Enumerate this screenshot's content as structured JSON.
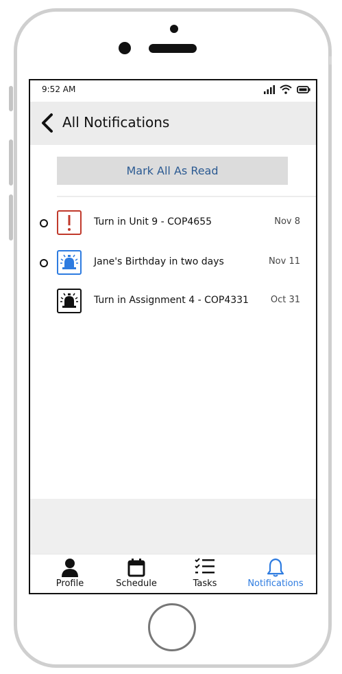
{
  "status_bar": {
    "time": "9:52 AM"
  },
  "header": {
    "title": "All Notifications"
  },
  "mark_all_button": {
    "label": "Mark All As Read",
    "color": "#2b5a92"
  },
  "notifications": [
    {
      "text": "Turn in Unit 9 - COP4655",
      "date": "Nov 8",
      "unread": true,
      "icon": "exclamation-icon",
      "icon_color": "#c0392b"
    },
    {
      "text": "Jane's Birthday in two days",
      "date": "Nov 11",
      "unread": true,
      "icon": "alarm-bell-icon",
      "icon_color": "#2d7be0"
    },
    {
      "text": "Turn in Assignment 4 - COP4331",
      "date": "Oct 31",
      "unread": false,
      "icon": "alarm-bell-icon",
      "icon_color": "#111111"
    }
  ],
  "tabs": [
    {
      "label": "Profile",
      "icon": "person-icon",
      "active": false
    },
    {
      "label": "Schedule",
      "icon": "calendar-icon",
      "active": false
    },
    {
      "label": "Tasks",
      "icon": "checklist-icon",
      "active": false
    },
    {
      "label": "Notifications",
      "icon": "bell-icon",
      "active": true
    }
  ],
  "active_color": "#2d7be0"
}
